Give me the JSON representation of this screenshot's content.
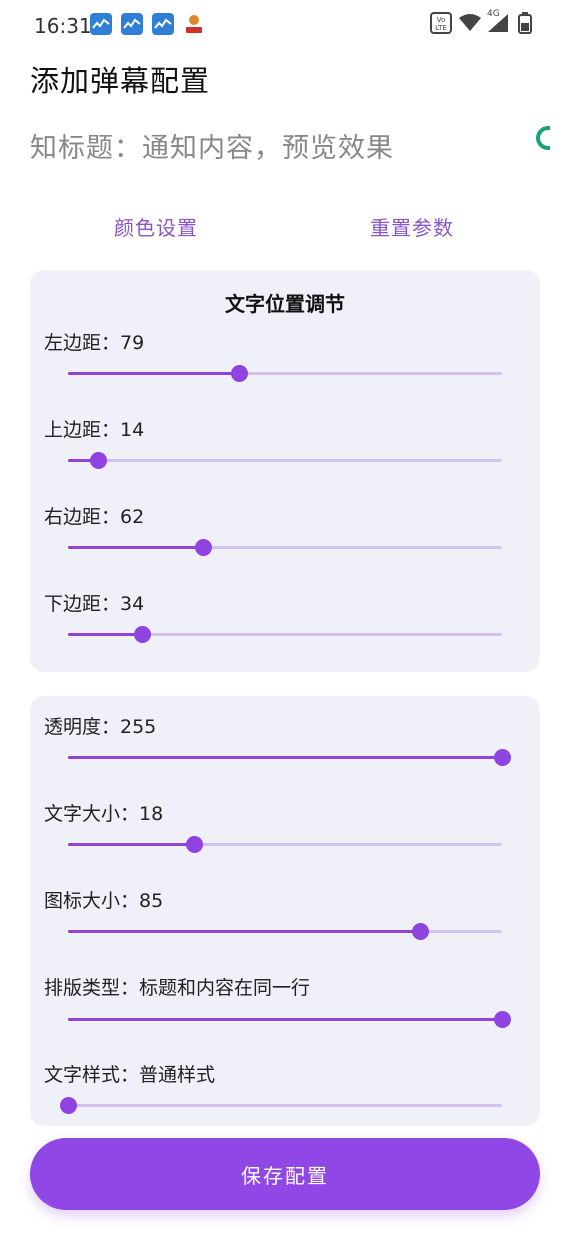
{
  "status_bar": {
    "time": "16:31",
    "icons": [
      "stocks-icon",
      "stocks-icon",
      "stocks-icon",
      "app-mascot-icon",
      "volte-icon",
      "wifi-icon",
      "signal-4g-icon",
      "battery-icon"
    ],
    "network": "4G"
  },
  "page": {
    "title": "添加弹幕配置",
    "preview_text": "知标题：通知内容，预览效果"
  },
  "actions": {
    "color_settings": "颜色设置",
    "reset_params": "重置参数"
  },
  "position_card": {
    "title": "文字位置调节",
    "sliders": [
      {
        "label": "左边距：79",
        "value": 79,
        "fraction": 0.395
      },
      {
        "label": "上边距：14",
        "value": 14,
        "fraction": 0.07
      },
      {
        "label": "右边距：62",
        "value": 62,
        "fraction": 0.31
      },
      {
        "label": "下边距：34",
        "value": 34,
        "fraction": 0.17
      }
    ]
  },
  "style_card": {
    "sliders": [
      {
        "label": "透明度：255",
        "value": 255,
        "fraction": 1.0
      },
      {
        "label": "文字大小：18",
        "value": 18,
        "fraction": 0.29
      },
      {
        "label": "图标大小：85",
        "value": 85,
        "fraction": 0.81
      },
      {
        "label": "排版类型：标题和内容在同一行",
        "value": "标题和内容在同一行",
        "fraction": 1.0
      },
      {
        "label": "文字样式：普通样式",
        "value": "普通样式",
        "fraction": 0.0
      }
    ]
  },
  "save_button": "保存配置",
  "colors": {
    "accent": "#8f48e6",
    "link": "#8a55c6",
    "card_bg": "#f0f1f8",
    "track_inactive": "#d3bff0"
  }
}
